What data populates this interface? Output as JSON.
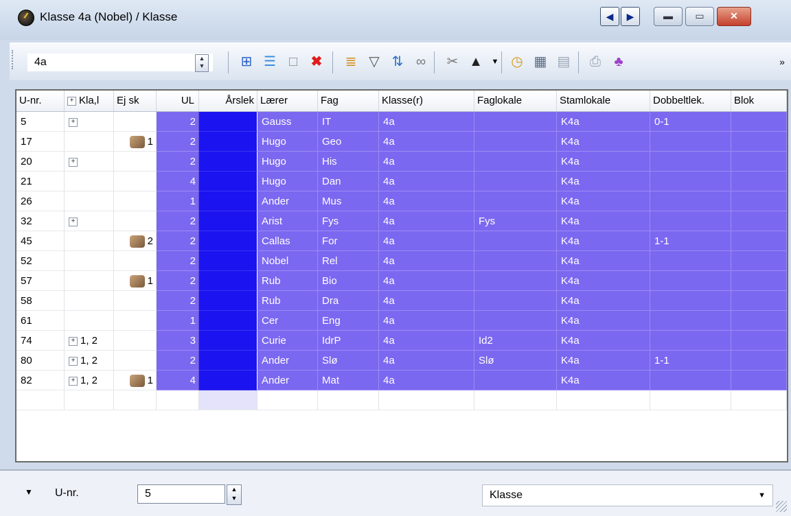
{
  "window": {
    "title": "Klasse 4a (Nobel) / Klasse"
  },
  "toolbar": {
    "combo_value": "4a"
  },
  "grid": {
    "headers": [
      "U-nr.",
      "Kla,l",
      "Ej sk",
      "UL",
      "Årslek",
      "Lærer",
      "Fag",
      "Klasse(r)",
      "Faglokale",
      "Stamlokale",
      "Dobbeltlek.",
      "Blok"
    ],
    "rows": [
      {
        "unr": "5",
        "kla": "",
        "ej": "",
        "ul": "2",
        "laerer": "Gauss",
        "fag": "IT",
        "klasse": "4a",
        "faglokale": "",
        "stamlokale": "K4a",
        "dobbelt": "0-1",
        "blok": ""
      },
      {
        "unr": "17",
        "kla": "",
        "ej": "1",
        "ul": "2",
        "laerer": "Hugo",
        "fag": "Geo",
        "klasse": "4a",
        "faglokale": "",
        "stamlokale": "K4a",
        "dobbelt": "",
        "blok": ""
      },
      {
        "unr": "20",
        "kla": "",
        "ej": "",
        "ul": "2",
        "laerer": "Hugo",
        "fag": "His",
        "klasse": "4a",
        "faglokale": "",
        "stamlokale": "K4a",
        "dobbelt": "",
        "blok": ""
      },
      {
        "unr": "21",
        "kla": "",
        "ej": "",
        "ul": "4",
        "laerer": "Hugo",
        "fag": "Dan",
        "klasse": "4a",
        "faglokale": "",
        "stamlokale": "K4a",
        "dobbelt": "",
        "blok": ""
      },
      {
        "unr": "26",
        "kla": "",
        "ej": "",
        "ul": "1",
        "laerer": "Ander",
        "fag": "Mus",
        "klasse": "4a",
        "faglokale": "",
        "stamlokale": "K4a",
        "dobbelt": "",
        "blok": ""
      },
      {
        "unr": "32",
        "kla": "",
        "ej": "",
        "ul": "2",
        "laerer": "Arist",
        "fag": "Fys",
        "klasse": "4a",
        "faglokale": "Fys",
        "stamlokale": "K4a",
        "dobbelt": "",
        "blok": ""
      },
      {
        "unr": "45",
        "kla": "",
        "ej": "2",
        "ul": "2",
        "laerer": "Callas",
        "fag": "For",
        "klasse": "4a",
        "faglokale": "",
        "stamlokale": "K4a",
        "dobbelt": "1-1",
        "blok": ""
      },
      {
        "unr": "52",
        "kla": "",
        "ej": "",
        "ul": "2",
        "laerer": "Nobel",
        "fag": "Rel",
        "klasse": "4a",
        "faglokale": "",
        "stamlokale": "K4a",
        "dobbelt": "",
        "blok": ""
      },
      {
        "unr": "57",
        "kla": "",
        "ej": "1",
        "ul": "2",
        "laerer": "Rub",
        "fag": "Bio",
        "klasse": "4a",
        "faglokale": "",
        "stamlokale": "K4a",
        "dobbelt": "",
        "blok": ""
      },
      {
        "unr": "58",
        "kla": "",
        "ej": "",
        "ul": "2",
        "laerer": "Rub",
        "fag": "Dra",
        "klasse": "4a",
        "faglokale": "",
        "stamlokale": "K4a",
        "dobbelt": "",
        "blok": ""
      },
      {
        "unr": "61",
        "kla": "",
        "ej": "",
        "ul": "1",
        "laerer": "Cer",
        "fag": "Eng",
        "klasse": "4a",
        "faglokale": "",
        "stamlokale": "K4a",
        "dobbelt": "",
        "blok": ""
      },
      {
        "unr": "74",
        "kla": "1, 2",
        "ej": "",
        "ul": "3",
        "laerer": "Curie",
        "fag": "IdrP",
        "klasse": "4a",
        "faglokale": "Id2",
        "stamlokale": "K4a",
        "dobbelt": "",
        "blok": ""
      },
      {
        "unr": "80",
        "kla": "1, 2",
        "ej": "",
        "ul": "2",
        "laerer": "Ander",
        "fag": "Slø",
        "klasse": "4a",
        "faglokale": "Slø",
        "stamlokale": "K4a",
        "dobbelt": "1-1",
        "blok": ""
      },
      {
        "unr": "82",
        "kla": "1, 2",
        "ej": "1",
        "ul": "4",
        "laerer": "Ander",
        "fag": "Mat",
        "klasse": "4a",
        "faglokale": "",
        "stamlokale": "K4a",
        "dobbelt": "",
        "blok": ""
      }
    ]
  },
  "footer": {
    "label": "U-nr.",
    "input_value": "5",
    "select_value": "Klasse"
  }
}
